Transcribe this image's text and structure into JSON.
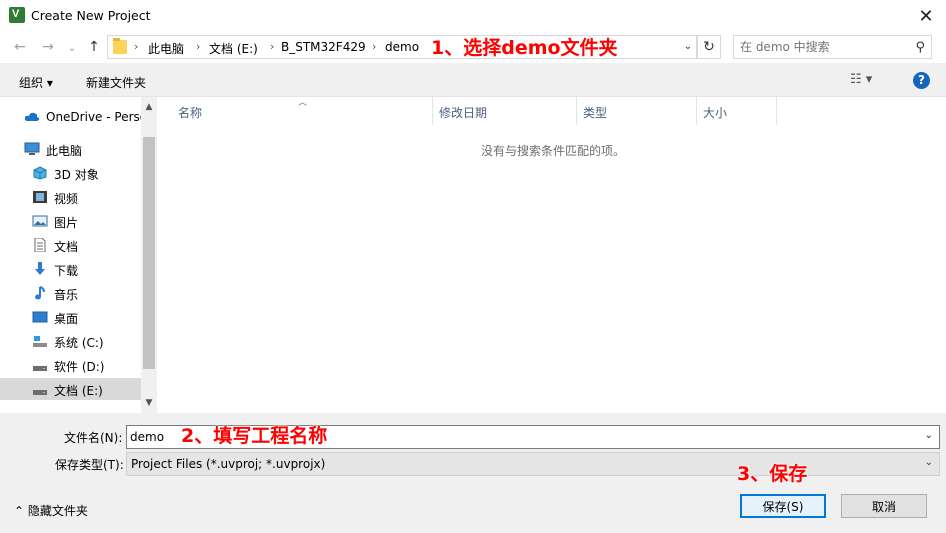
{
  "window": {
    "title": "Create New Project",
    "app_icon_letter": "V",
    "close_glyph": "✕"
  },
  "nav_buttons": {
    "back": "←",
    "forward": "→",
    "recent": "⌄",
    "up": "↑"
  },
  "address": {
    "breadcrumbs": [
      "此电脑",
      "文档 (E:)",
      "B_STM32F429",
      "demo"
    ],
    "separator": "›",
    "dropdown": "⌄",
    "refresh": "↻"
  },
  "search": {
    "placeholder": "在 demo 中搜索",
    "icon": "search-icon"
  },
  "annotations": {
    "step1": "1、选择demo文件夹",
    "step2": "2、填写工程名称",
    "step3": "3、保存",
    "color": "#ff0000"
  },
  "toolbar": {
    "organize": "组织 ▾",
    "new_folder": "新建文件夹",
    "view": "☷ ▾",
    "help": "?"
  },
  "sidebar": {
    "items": [
      {
        "label": "OneDrive - Perso",
        "icon": "cloud-icon"
      },
      {
        "label": "此电脑",
        "icon": "computer-icon"
      },
      {
        "label": "3D 对象",
        "icon": "cube-icon"
      },
      {
        "label": "视频",
        "icon": "video-icon"
      },
      {
        "label": "图片",
        "icon": "picture-icon"
      },
      {
        "label": "文档",
        "icon": "document-icon"
      },
      {
        "label": "下载",
        "icon": "download-icon"
      },
      {
        "label": "音乐",
        "icon": "music-icon"
      },
      {
        "label": "桌面",
        "icon": "desktop-icon"
      },
      {
        "label": "系统 (C:)",
        "icon": "drive-icon"
      },
      {
        "label": "软件 (D:)",
        "icon": "drive-icon"
      },
      {
        "label": "文档 (E:)",
        "icon": "drive-icon"
      }
    ],
    "selected_index": 11
  },
  "filelist": {
    "columns": [
      "名称",
      "修改日期",
      "类型",
      "大小"
    ],
    "empty_message": "没有与搜索条件匹配的项。"
  },
  "bottom": {
    "filename_label": "文件名(N):",
    "filename_value": "demo",
    "filetype_label": "保存类型(T):",
    "filetype_value": "Project Files (*.uvproj; *.uvprojx)",
    "save_label": "保存(S)",
    "cancel_label": "取消",
    "hide_folders_label": "⌃  隐藏文件夹"
  },
  "colors": {
    "accent": "#0078d7",
    "selection": "#cce8ff",
    "toolbar_bg": "#f0f0f0"
  }
}
